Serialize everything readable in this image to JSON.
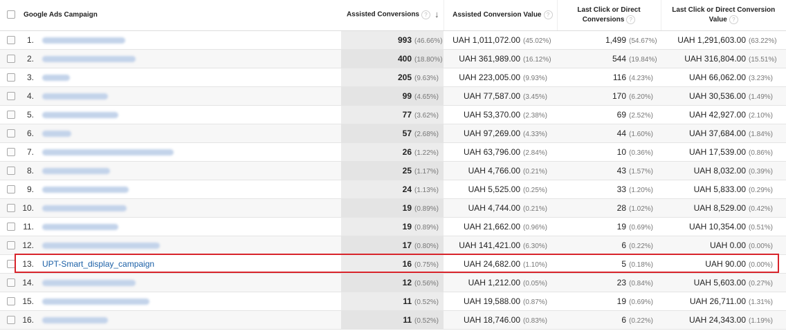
{
  "header": {
    "campaign": "Google Ads Campaign",
    "assisted_conversions": "Assisted Conversions",
    "assisted_conversion_value": "Assisted Conversion Value",
    "last_click_conversions_l1": "Last Click or Direct",
    "last_click_conversions_l2": "Conversions",
    "last_click_value_l1": "Last Click or Direct Conversion",
    "last_click_value_l2": "Value",
    "help_glyph": "?",
    "sort_glyph": "↓"
  },
  "highlighted_row": 13,
  "rows": [
    {
      "n": "1.",
      "name": "",
      "ac": "993",
      "ac_pct": "(46.66%)",
      "acv": "UAH 1,011,072.00",
      "acv_pct": "(45.02%)",
      "lc": "1,499",
      "lc_pct": "(54.67%)",
      "lcv": "UAH 1,291,603.00",
      "lcv_pct": "(63.22%)"
    },
    {
      "n": "2.",
      "name": "",
      "ac": "400",
      "ac_pct": "(18.80%)",
      "acv": "UAH 361,989.00",
      "acv_pct": "(16.12%)",
      "lc": "544",
      "lc_pct": "(19.84%)",
      "lcv": "UAH 316,804.00",
      "lcv_pct": "(15.51%)"
    },
    {
      "n": "3.",
      "name": "",
      "ac": "205",
      "ac_pct": "(9.63%)",
      "acv": "UAH 223,005.00",
      "acv_pct": "(9.93%)",
      "lc": "116",
      "lc_pct": "(4.23%)",
      "lcv": "UAH 66,062.00",
      "lcv_pct": "(3.23%)"
    },
    {
      "n": "4.",
      "name": "",
      "ac": "99",
      "ac_pct": "(4.65%)",
      "acv": "UAH 77,587.00",
      "acv_pct": "(3.45%)",
      "lc": "170",
      "lc_pct": "(6.20%)",
      "lcv": "UAH 30,536.00",
      "lcv_pct": "(1.49%)"
    },
    {
      "n": "5.",
      "name": "",
      "ac": "77",
      "ac_pct": "(3.62%)",
      "acv": "UAH 53,370.00",
      "acv_pct": "(2.38%)",
      "lc": "69",
      "lc_pct": "(2.52%)",
      "lcv": "UAH 42,927.00",
      "lcv_pct": "(2.10%)"
    },
    {
      "n": "6.",
      "name": "",
      "ac": "57",
      "ac_pct": "(2.68%)",
      "acv": "UAH 97,269.00",
      "acv_pct": "(4.33%)",
      "lc": "44",
      "lc_pct": "(1.60%)",
      "lcv": "UAH 37,684.00",
      "lcv_pct": "(1.84%)"
    },
    {
      "n": "7.",
      "name": "",
      "ac": "26",
      "ac_pct": "(1.22%)",
      "acv": "UAH 63,796.00",
      "acv_pct": "(2.84%)",
      "lc": "10",
      "lc_pct": "(0.36%)",
      "lcv": "UAH 17,539.00",
      "lcv_pct": "(0.86%)"
    },
    {
      "n": "8.",
      "name": "",
      "ac": "25",
      "ac_pct": "(1.17%)",
      "acv": "UAH 4,766.00",
      "acv_pct": "(0.21%)",
      "lc": "43",
      "lc_pct": "(1.57%)",
      "lcv": "UAH 8,032.00",
      "lcv_pct": "(0.39%)"
    },
    {
      "n": "9.",
      "name": "",
      "ac": "24",
      "ac_pct": "(1.13%)",
      "acv": "UAH 5,525.00",
      "acv_pct": "(0.25%)",
      "lc": "33",
      "lc_pct": "(1.20%)",
      "lcv": "UAH 5,833.00",
      "lcv_pct": "(0.29%)"
    },
    {
      "n": "10.",
      "name": "",
      "ac": "19",
      "ac_pct": "(0.89%)",
      "acv": "UAH 4,744.00",
      "acv_pct": "(0.21%)",
      "lc": "28",
      "lc_pct": "(1.02%)",
      "lcv": "UAH 8,529.00",
      "lcv_pct": "(0.42%)"
    },
    {
      "n": "11.",
      "name": "",
      "ac": "19",
      "ac_pct": "(0.89%)",
      "acv": "UAH 21,662.00",
      "acv_pct": "(0.96%)",
      "lc": "19",
      "lc_pct": "(0.69%)",
      "lcv": "UAH 10,354.00",
      "lcv_pct": "(0.51%)"
    },
    {
      "n": "12.",
      "name": "",
      "ac": "17",
      "ac_pct": "(0.80%)",
      "acv": "UAH 141,421.00",
      "acv_pct": "(6.30%)",
      "lc": "6",
      "lc_pct": "(0.22%)",
      "lcv": "UAH 0.00",
      "lcv_pct": "(0.00%)"
    },
    {
      "n": "13.",
      "name": "UPT-Smart_display_campaign",
      "ac": "16",
      "ac_pct": "(0.75%)",
      "acv": "UAH 24,682.00",
      "acv_pct": "(1.10%)",
      "lc": "5",
      "lc_pct": "(0.18%)",
      "lcv": "UAH 90.00",
      "lcv_pct": "(0.00%)"
    },
    {
      "n": "14.",
      "name": "",
      "ac": "12",
      "ac_pct": "(0.56%)",
      "acv": "UAH 1,212.00",
      "acv_pct": "(0.05%)",
      "lc": "23",
      "lc_pct": "(0.84%)",
      "lcv": "UAH 5,603.00",
      "lcv_pct": "(0.27%)"
    },
    {
      "n": "15.",
      "name": "",
      "ac": "11",
      "ac_pct": "(0.52%)",
      "acv": "UAH 19,588.00",
      "acv_pct": "(0.87%)",
      "lc": "19",
      "lc_pct": "(0.69%)",
      "lcv": "UAH 26,711.00",
      "lcv_pct": "(1.31%)"
    },
    {
      "n": "16.",
      "name": "",
      "ac": "11",
      "ac_pct": "(0.52%)",
      "acv": "UAH 18,746.00",
      "acv_pct": "(0.83%)",
      "lc": "6",
      "lc_pct": "(0.22%)",
      "lcv": "UAH 24,343.00",
      "lcv_pct": "(1.19%)"
    }
  ],
  "colors": {
    "link": "#1a5fa6",
    "highlight_border": "#d8232a"
  }
}
